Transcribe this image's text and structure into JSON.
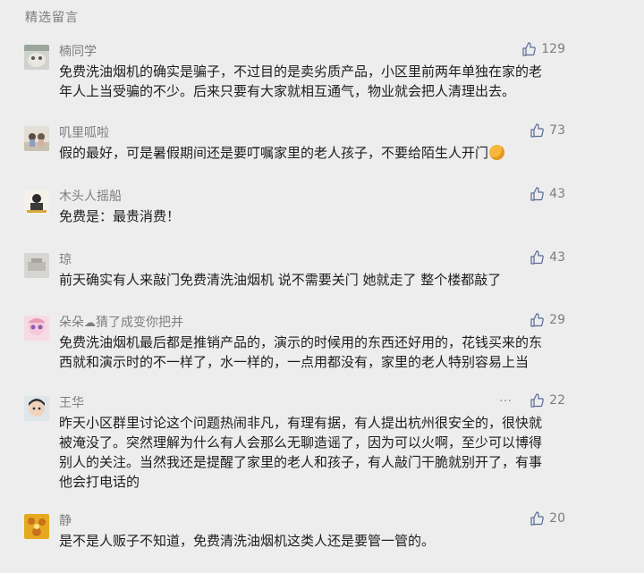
{
  "section_title": "精选留言",
  "comments": [
    {
      "name": "楠同学",
      "likes": "129",
      "text": "免费洗油烟机的确实是骗子，不过目的是卖劣质产品，小区里前两年单独在家的老\n年人上当受骗的不少。后来只要有大家就相互通气，物业就会把人清理出去。"
    },
    {
      "name": "叽里呱啦",
      "likes": "73",
      "text": "假的最好，可是暑假期间还是要叮嘱家里的老人孩子，不要给陌生人开门"
    },
    {
      "name": "木头人摇船",
      "likes": "43",
      "text": "免费是：最贵消费！"
    },
    {
      "name": "琼",
      "likes": "43",
      "text": "前天确实有人来敲门免费清洗油烟机 说不需要关门 她就走了 整个楼都敲了"
    },
    {
      "name_a": "朵朵",
      "name_b": "猜了成变你把并",
      "likes": "29",
      "text": "免费洗油烟机最后都是推销产品的，演示的时候用的东西还好用的，花钱买来的东\n西就和演示时的不一样了，水一样的，一点用都没有，家里的老人特别容易上当"
    },
    {
      "name": "王华",
      "likes": "22",
      "more": "…",
      "text": "昨天小区群里讨论这个问题热闹非凡，有理有据，有人提出杭州很安全的，很快就\n被淹没了。突然理解为什么有人会那么无聊造谣了，因为可以火啊，至少可以博得\n别人的关注。当然我还是提醒了家里的老人和孩子，有人敲门干脆就别开了，有事\n他会打电话的"
    },
    {
      "name": "静",
      "likes": "20",
      "text": "是不是人贩子不知道，免费清洗油烟机这类人还是要管一管的。"
    }
  ]
}
